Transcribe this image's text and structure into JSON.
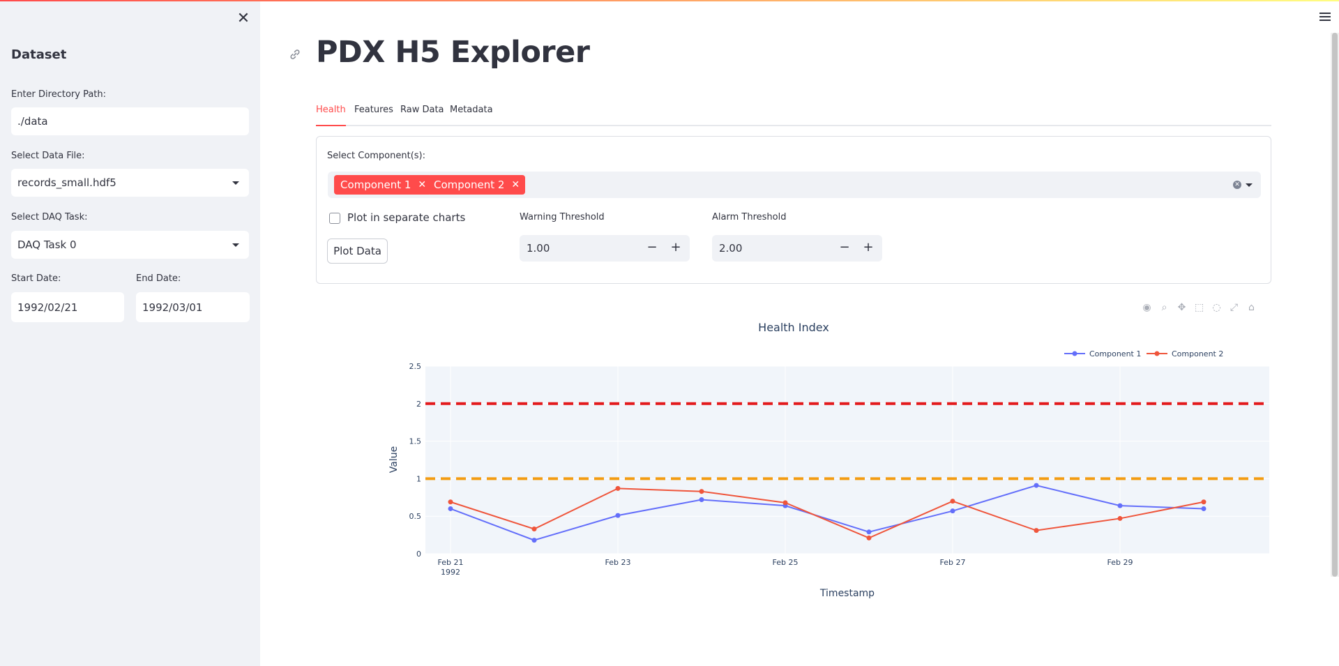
{
  "sidebar": {
    "title": "Dataset",
    "dir_label": "Enter Directory Path:",
    "dir_value": "./data",
    "file_label": "Select Data File:",
    "file_value": "records_small.hdf5",
    "daq_label": "Select DAQ Task:",
    "daq_value": "DAQ Task 0",
    "start_label": "Start Date:",
    "start_value": "1992/02/21",
    "end_label": "End Date:",
    "end_value": "1992/03/01"
  },
  "page": {
    "title": "PDX H5 Explorer"
  },
  "tabs": [
    "Health",
    "Features",
    "Raw Data",
    "Metadata"
  ],
  "panel": {
    "select_label": "Select Component(s):",
    "chips": [
      "Component 1",
      "Component 2"
    ],
    "checkbox_label": "Plot in separate charts",
    "plot_button": "Plot Data",
    "warning_label": "Warning Threshold",
    "warning_value": "1.00",
    "alarm_label": "Alarm Threshold",
    "alarm_value": "2.00"
  },
  "icons": {
    "toolbar": [
      "camera-icon",
      "zoom-icon",
      "pan-icon",
      "box-select-icon",
      "lasso-icon",
      "autoscale-icon",
      "home-icon"
    ]
  },
  "chart_data": {
    "type": "line",
    "title": "Health Index",
    "xlabel": "Timestamp",
    "ylabel": "Value",
    "x": [
      "1992-02-21",
      "1992-02-22",
      "1992-02-23",
      "1992-02-24",
      "1992-02-25",
      "1992-02-26",
      "1992-02-27",
      "1992-02-28",
      "1992-02-29",
      "1992-03-01"
    ],
    "x_tick_labels": [
      "Feb 21",
      "Feb 23",
      "Feb 25",
      "Feb 27",
      "Feb 29"
    ],
    "x_tick_sublabel": "1992",
    "y_ticks": [
      "0",
      "0.5",
      "1",
      "1.5",
      "2",
      "2.5"
    ],
    "ylim": [
      0,
      2.5
    ],
    "series": [
      {
        "name": "Component 1",
        "color": "#636efa",
        "values": [
          0.6,
          0.18,
          0.51,
          0.72,
          0.64,
          0.29,
          0.57,
          0.91,
          0.64,
          0.6
        ]
      },
      {
        "name": "Component 2",
        "color": "#ef553b",
        "values": [
          0.69,
          0.33,
          0.87,
          0.83,
          0.68,
          0.21,
          0.7,
          0.31,
          0.47,
          0.69
        ]
      }
    ],
    "threshold_lines": [
      {
        "value": 2.0,
        "color": "#e31a1c"
      },
      {
        "value": 1.0,
        "color": "#f39c12"
      }
    ],
    "legend_position": "top-right",
    "grid": true
  }
}
